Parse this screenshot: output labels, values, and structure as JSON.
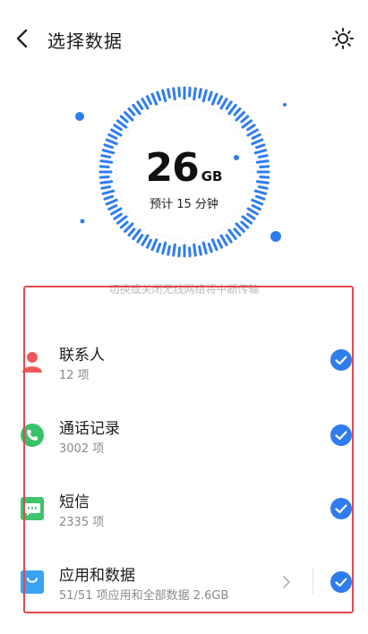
{
  "header": {
    "title": "选择数据"
  },
  "summary": {
    "size": "26",
    "unit": "GB",
    "estimate": "预计 15 分钟"
  },
  "notice": "切换或关闭无线网络将中断传输",
  "items": [
    {
      "label": "联系人",
      "count": "12 项",
      "icon": "contact-icon",
      "checked": true
    },
    {
      "label": "通话记录",
      "count": "3002 项",
      "icon": "phone-icon",
      "checked": true
    },
    {
      "label": "短信",
      "count": "2335 项",
      "icon": "message-icon",
      "checked": true
    },
    {
      "label": "应用和数据",
      "count": "51/51 项应用和全部数据 2.6GB",
      "icon": "app-icon",
      "checked": true
    }
  ],
  "colors": {
    "accent": "#2f7cf0",
    "highlight_border": "#e04a4e",
    "contact": "#f0585b",
    "phone": "#37c26a",
    "message": "#3fc56d",
    "app": "#3aa2f2"
  }
}
